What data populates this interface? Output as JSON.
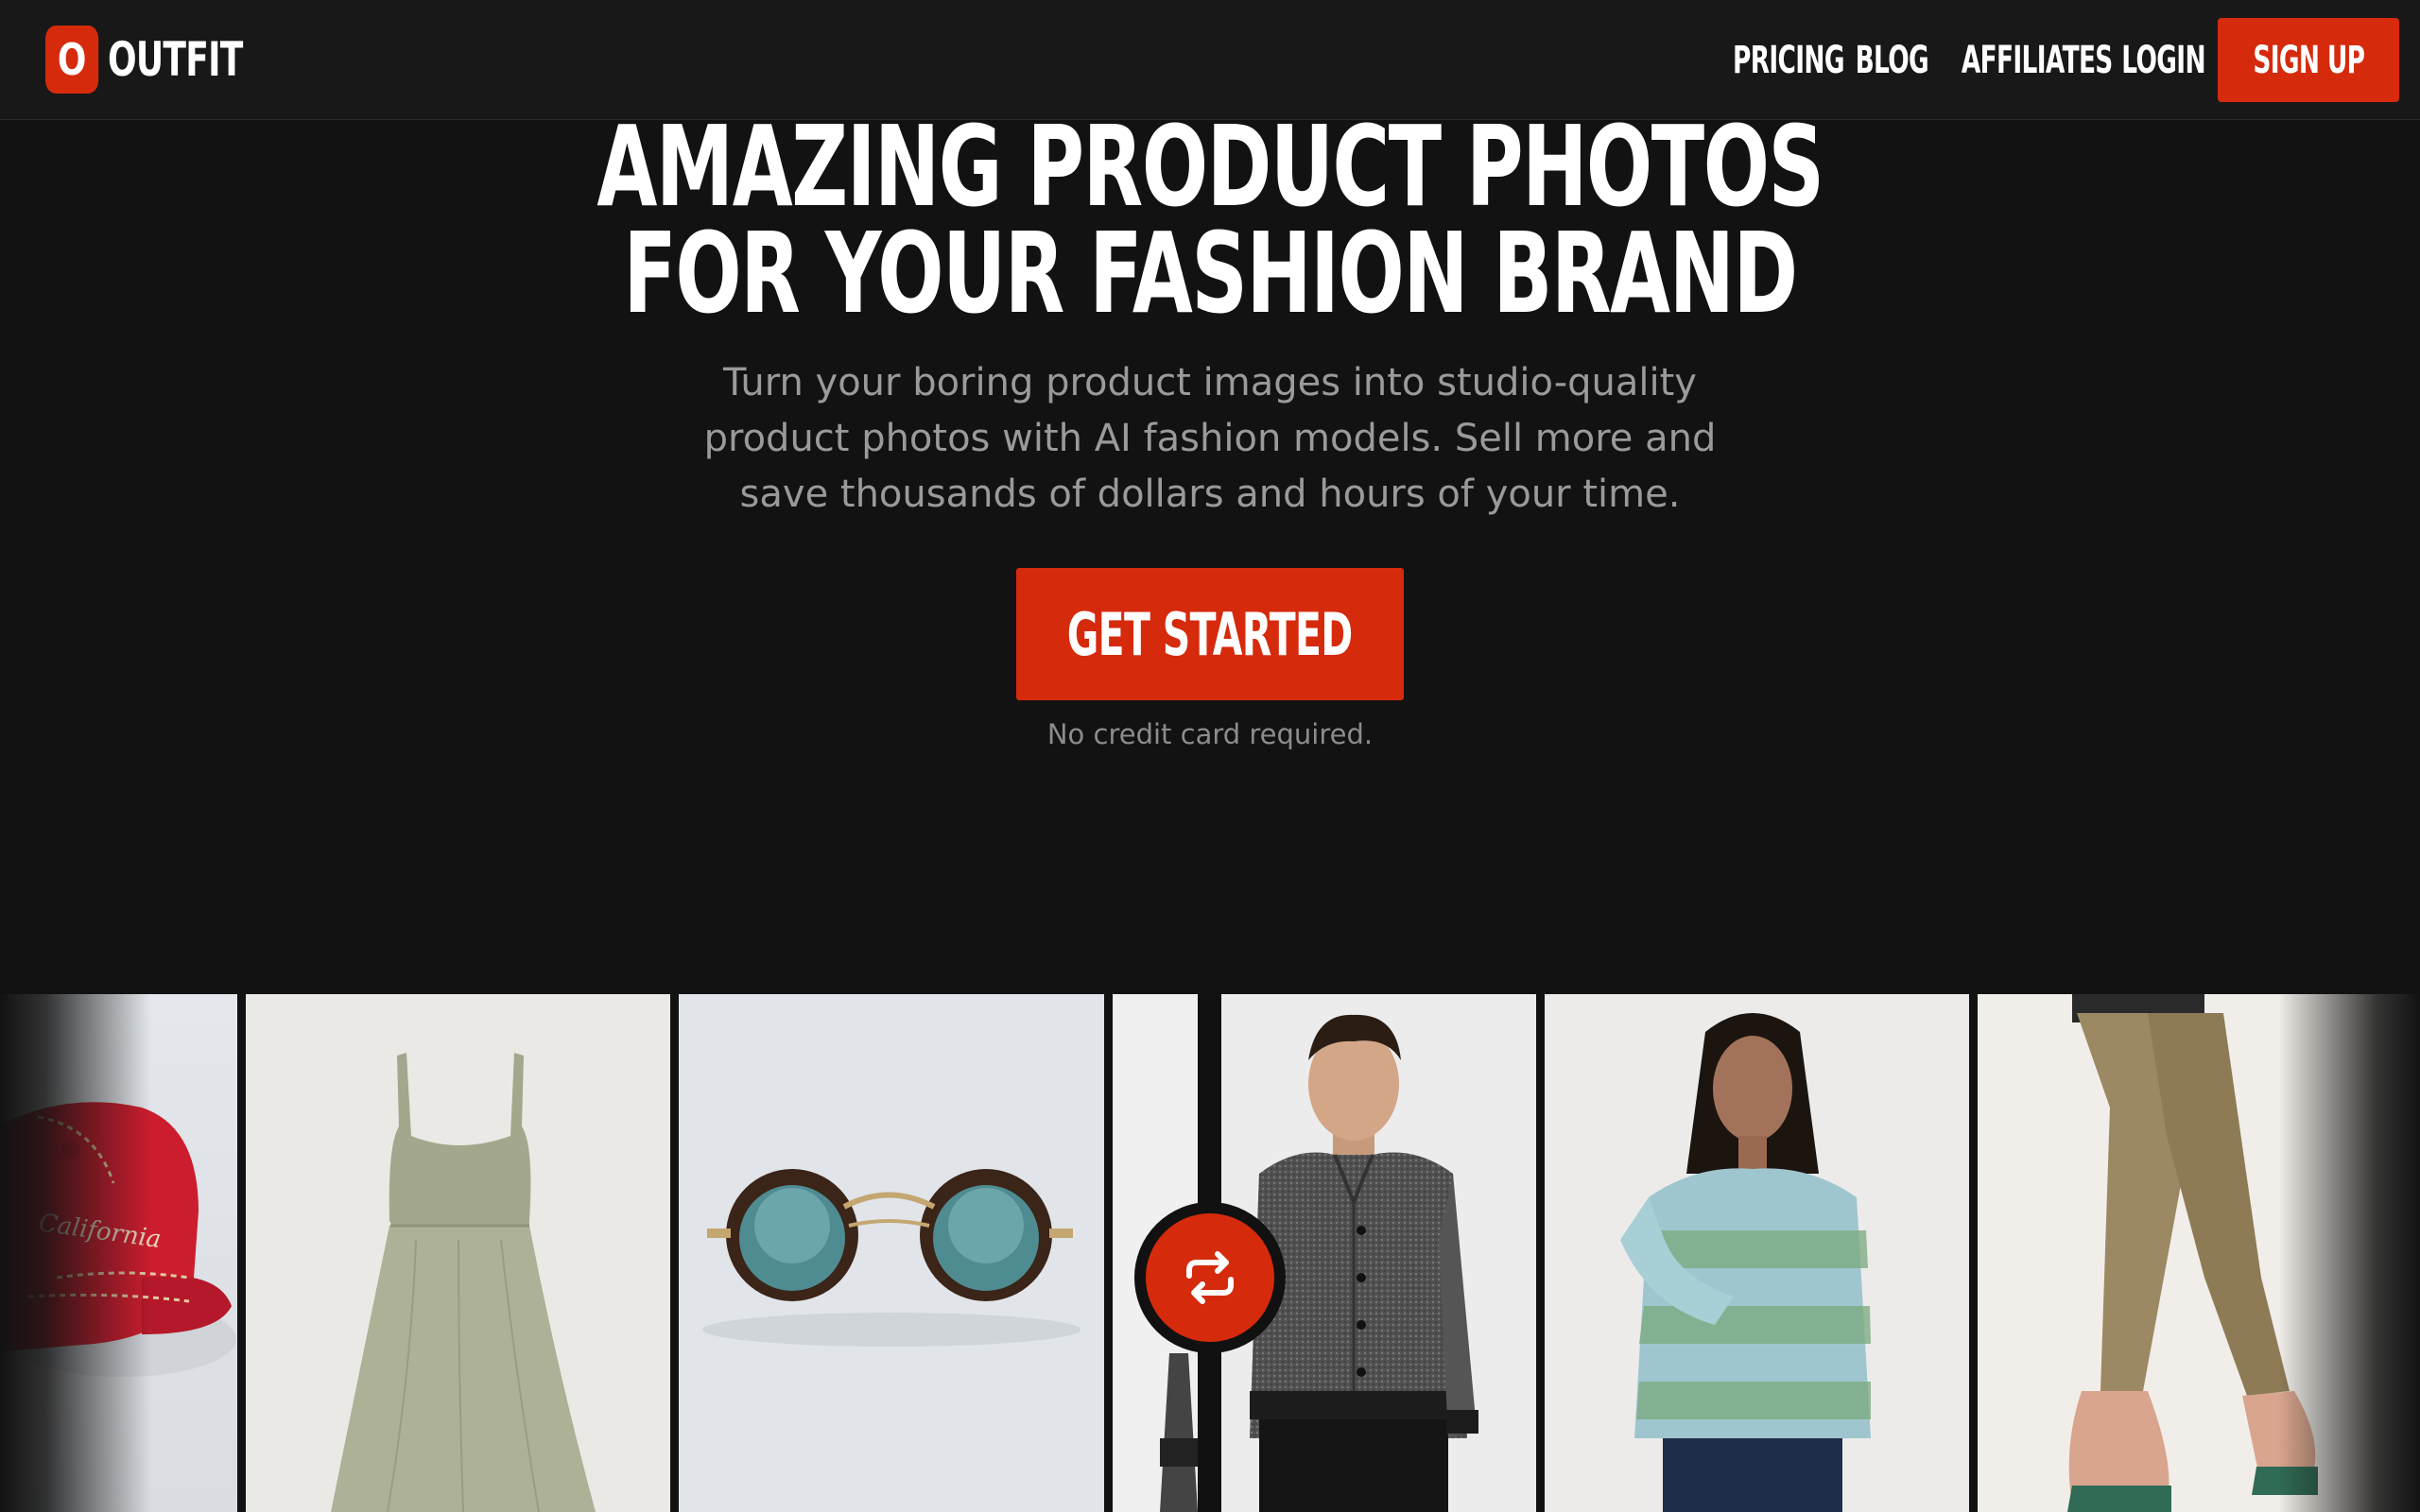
{
  "brand": {
    "logo_letter": "O",
    "name": "OUTFIT",
    "accent_color": "#d62a0c"
  },
  "nav": {
    "links": [
      "PRICING",
      "BLOG",
      "AFFILIATES",
      "LOGIN"
    ],
    "signup_label": "SIGN UP"
  },
  "hero": {
    "headline_line1": "AMAZING PRODUCT PHOTOS",
    "headline_line2": "FOR YOUR FASHION BRAND",
    "subtitle_line1": "Turn your boring product images into studio-quality",
    "subtitle_line2": "product photos with AI fashion models. Sell more and",
    "subtitle_line3": "save thousands of dollars and hours of your time.",
    "cta_label": "GET STARTED",
    "note": "No credit card required."
  },
  "gallery": {
    "cap_script_text": "California",
    "panels": [
      {
        "name": "red-cap-photo"
      },
      {
        "name": "sage-dress-photo"
      },
      {
        "name": "sunglasses-photo"
      },
      {
        "name": "jacket-partial-photo"
      },
      {
        "name": "male-model-jacket-photo"
      },
      {
        "name": "female-model-sweater-photo"
      },
      {
        "name": "khaki-pants-sneakers-photo"
      }
    ],
    "swap_icon": "swap-arrows-icon"
  }
}
